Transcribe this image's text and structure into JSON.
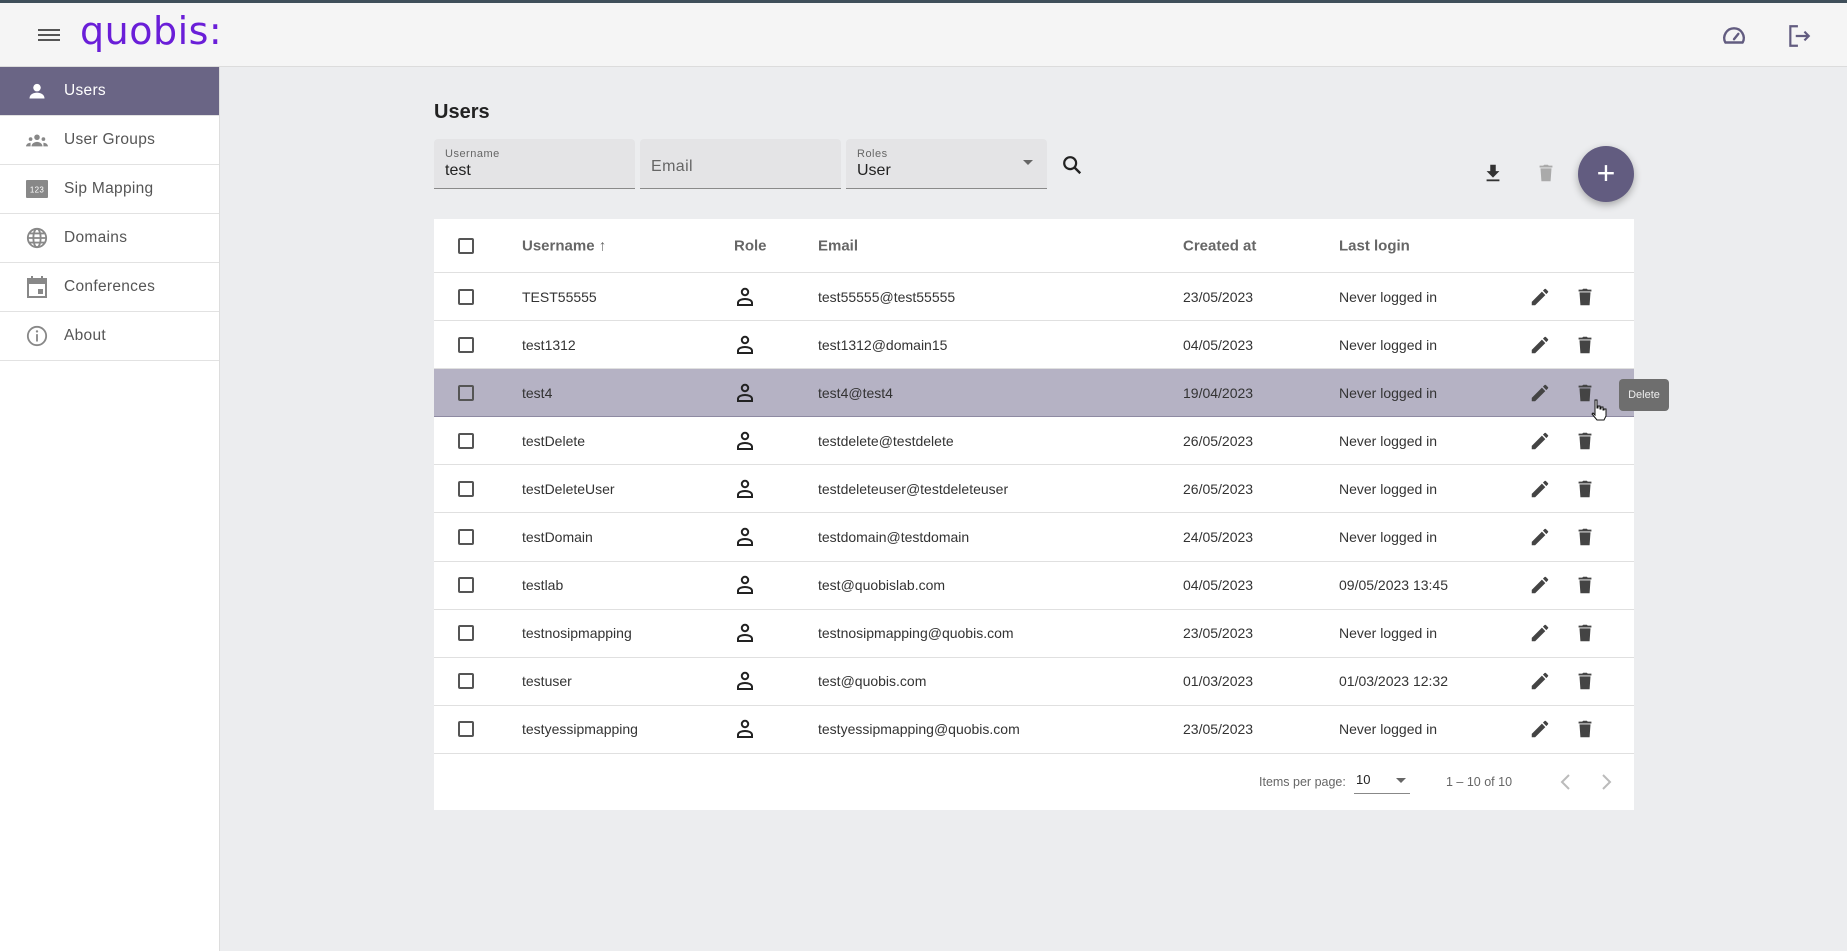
{
  "app": {
    "logo": "quobis:"
  },
  "header": {
    "icons": [
      "menu-icon",
      "dashboard-icon",
      "logout-icon"
    ]
  },
  "sidebar": {
    "items": [
      {
        "label": "Users",
        "icon": "person-icon",
        "active": true
      },
      {
        "label": "User Groups",
        "icon": "groups-icon"
      },
      {
        "label": "Sip Mapping",
        "icon": "dialpad-123-icon"
      },
      {
        "label": "Domains",
        "icon": "globe-icon"
      },
      {
        "label": "Conferences",
        "icon": "calendar-icon"
      },
      {
        "label": "About",
        "icon": "info-icon"
      }
    ]
  },
  "page": {
    "title": "Users"
  },
  "filters": {
    "username": {
      "label": "Username",
      "value": "test"
    },
    "email": {
      "placeholder": "Email"
    },
    "roles": {
      "label": "Roles",
      "value": "User"
    }
  },
  "toolbar": {
    "add_label": "+"
  },
  "table": {
    "columns": [
      "Username",
      "Role",
      "Email",
      "Created at",
      "Last login"
    ],
    "sort_indicator": "↑",
    "rows": [
      {
        "username": "TEST55555",
        "email": "test55555@test55555",
        "created": "23/05/2023",
        "last_login": "Never logged in"
      },
      {
        "username": "test1312",
        "email": "test1312@domain15",
        "created": "04/05/2023",
        "last_login": "Never logged in"
      },
      {
        "username": "test4",
        "email": "test4@test4",
        "created": "19/04/2023",
        "last_login": "Never logged in"
      },
      {
        "username": "testDelete",
        "email": "testdelete@testdelete",
        "created": "26/05/2023",
        "last_login": "Never logged in"
      },
      {
        "username": "testDeleteUser",
        "email": "testdeleteuser@testdeleteuser",
        "created": "26/05/2023",
        "last_login": "Never logged in"
      },
      {
        "username": "testDomain",
        "email": "testdomain@testdomain",
        "created": "24/05/2023",
        "last_login": "Never logged in"
      },
      {
        "username": "testlab",
        "email": "test@quobislab.com",
        "created": "04/05/2023",
        "last_login": "09/05/2023 13:45"
      },
      {
        "username": "testnosipmapping",
        "email": "testnosipmapping@quobis.com",
        "created": "23/05/2023",
        "last_login": "Never logged in"
      },
      {
        "username": "testuser",
        "email": "test@quobis.com",
        "created": "01/03/2023",
        "last_login": "01/03/2023 12:32"
      },
      {
        "username": "testyessipmapping",
        "email": "testyessipmapping@quobis.com",
        "created": "23/05/2023",
        "last_login": "Never logged in"
      }
    ]
  },
  "paginator": {
    "items_per_page_label": "Items per page:",
    "items_per_page": "10",
    "range": "1 – 10 of 10"
  },
  "tooltip": {
    "text": "Delete"
  },
  "colors": {
    "accent": "#625c80",
    "sidebar_active": "#6a6585",
    "row_hover": "#b5b2c4",
    "logo": "#6a1ed8"
  }
}
